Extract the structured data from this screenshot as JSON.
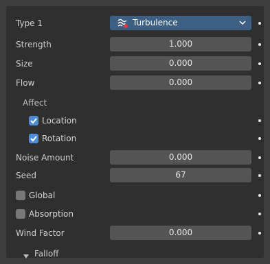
{
  "type": {
    "label": "Type 1",
    "value": "Turbulence",
    "icon": "turbulence-icon",
    "chevron": "chevron-down-icon"
  },
  "strength": {
    "label": "Strength",
    "value": "1.000"
  },
  "size": {
    "label": "Size",
    "value": "0.000"
  },
  "flow": {
    "label": "Flow",
    "value": "0.000"
  },
  "affect": {
    "label": "Affect",
    "location": {
      "label": "Location",
      "checked": true
    },
    "rotation": {
      "label": "Rotation",
      "checked": true
    }
  },
  "noise_amount": {
    "label": "Noise Amount",
    "value": "0.000"
  },
  "seed": {
    "label": "Seed",
    "value": "67"
  },
  "global": {
    "label": "Global",
    "checked": false
  },
  "absorption": {
    "label": "Absorption",
    "checked": false
  },
  "wind_factor": {
    "label": "Wind Factor",
    "value": "0.000"
  },
  "falloff": {
    "label": "Falloff",
    "expanded": false
  },
  "colors": {
    "panel_bg": "#2f2f2f",
    "field_bg": "#545454",
    "dropdown_bg": "#3e5f84",
    "checkbox_on": "#4e8ed8",
    "checkbox_off": "#787878"
  }
}
